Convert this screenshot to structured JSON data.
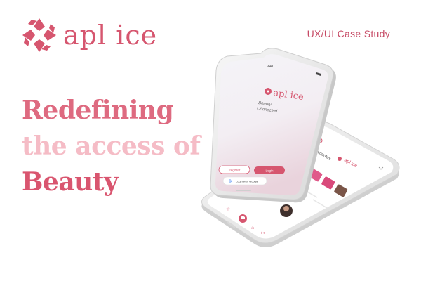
{
  "brand": {
    "name": "apl ice",
    "accent": "#d6566f",
    "light_accent": "#f5bcc6"
  },
  "header": {
    "case_study": "UX/UI Case Study"
  },
  "headline": {
    "line1": "Redefining",
    "line2": "the access of",
    "line3": "Beauty"
  },
  "front_phone": {
    "status_time": "9:41",
    "app_name": "apl ice",
    "tagline_1": "Beauty",
    "tagline_2": "Connected",
    "register_label": "Register",
    "login_label": "Login",
    "google_label": "Login with Google",
    "google_icon_letter": "G"
  },
  "back_phone": {
    "app_name": "apl ice",
    "favourites_label": "Favourites"
  }
}
